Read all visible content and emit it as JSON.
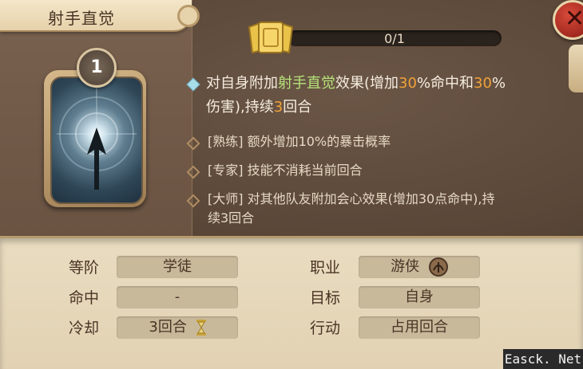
{
  "skill": {
    "title": "射手直觉",
    "level": "1",
    "progress": {
      "text": "0/1",
      "fraction": 0
    }
  },
  "description": {
    "main": {
      "segments": [
        {
          "text": "对自身附加",
          "style": "plain"
        },
        {
          "text": "射手直觉",
          "style": "green"
        },
        {
          "text": "效果(增加",
          "style": "plain"
        },
        {
          "text": "30",
          "style": "orange"
        },
        {
          "text": "%命中和",
          "style": "plain"
        },
        {
          "text": "30",
          "style": "orange"
        },
        {
          "text": "%",
          "style": "plain"
        }
      ],
      "line2": [
        {
          "text": "伤害),持续",
          "style": "plain"
        },
        {
          "text": "3",
          "style": "orange"
        },
        {
          "text": "回合",
          "style": "plain"
        }
      ]
    },
    "masteries": [
      {
        "line1": "[熟练] 额外增加10%的暴击概率",
        "line2": ""
      },
      {
        "line1": "[专家] 技能不消耗当前回合",
        "line2": ""
      },
      {
        "line1": "[大师] 对其他队友附加会心效果(增加30点命中),持",
        "line2": "续3回合"
      }
    ]
  },
  "stats": {
    "rank": {
      "label": "等阶",
      "value": "学徒"
    },
    "hit": {
      "label": "命中",
      "value": "-"
    },
    "cooldown": {
      "label": "冷却",
      "value": "3回合"
    },
    "job": {
      "label": "职业",
      "value": "游侠"
    },
    "target": {
      "label": "目标",
      "value": "自身"
    },
    "action": {
      "label": "行动",
      "value": "占用回合"
    }
  },
  "watermark": "Easck. Net",
  "icons": {
    "close": "close-icon",
    "token": "card-token-icon",
    "arrow": "arrow-skill-icon",
    "hourglass": "hourglass-icon",
    "class": "ranger-class-icon"
  },
  "colors": {
    "highlight_green": "#b6e27a",
    "highlight_orange": "#f0a23a",
    "panel_dark": "#5e4a3c",
    "panel_light": "#e6d6b6"
  }
}
